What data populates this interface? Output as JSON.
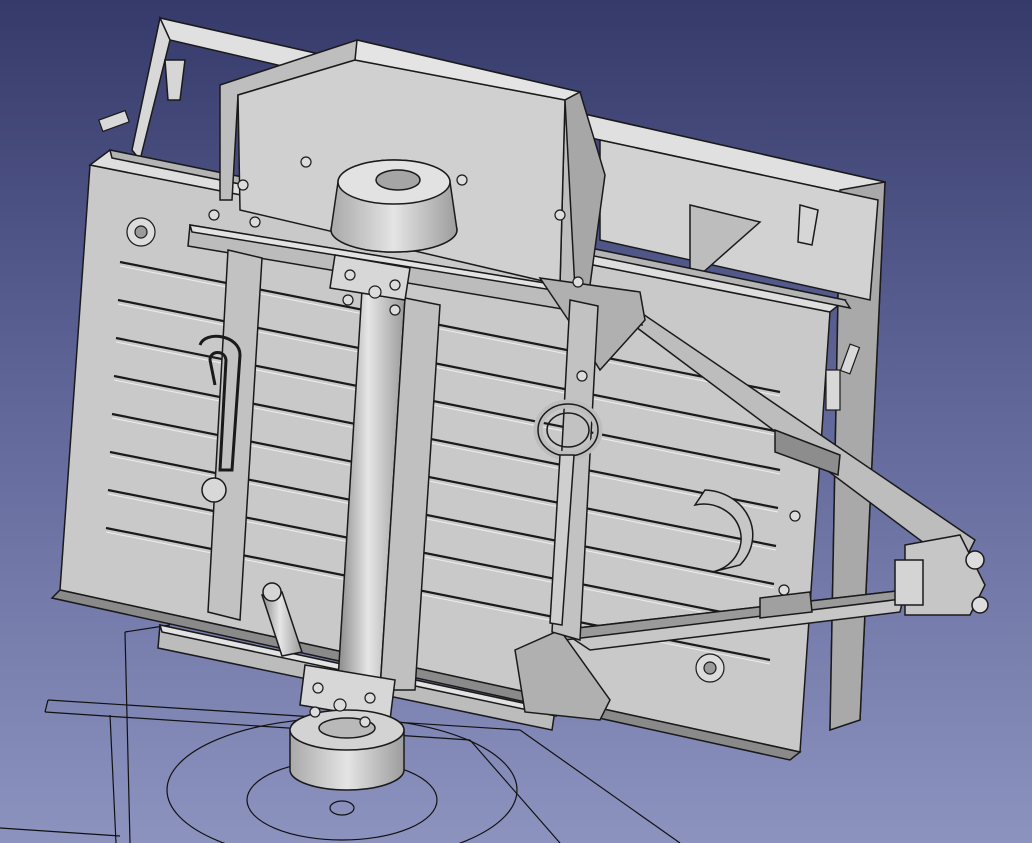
{
  "app": {
    "view": "3d-viewport",
    "background_top": "#353a6a",
    "background_bottom": "#8d93bf"
  },
  "model": {
    "parts": [
      "trailer-bed",
      "front-wall",
      "rear-panel",
      "axle-tube",
      "wheel-hub-top",
      "wheel-hub-bottom",
      "leaf-spring-left",
      "leaf-spring-right",
      "drawbar-left-arm",
      "drawbar-right-arm",
      "tow-hitch",
      "shock-absorber",
      "lifting-eye-ring",
      "spare-wheel-bracket"
    ],
    "colors": {
      "shaded": "#c9c9c9",
      "light": "#e2e2e2",
      "dark": "#8a8a8a",
      "edge": "#1a1a1a"
    }
  },
  "sketch": {
    "color": "#111111"
  }
}
